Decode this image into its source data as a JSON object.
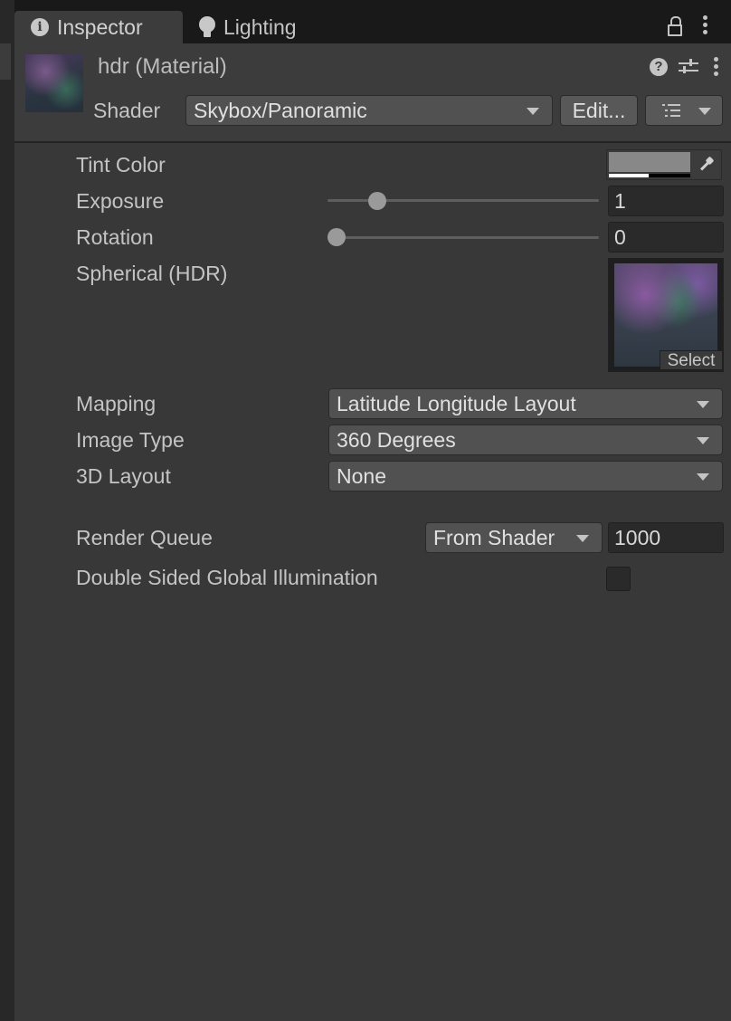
{
  "tabs": [
    {
      "label": "Inspector",
      "icon": "info-icon",
      "active": true
    },
    {
      "label": "Lighting",
      "icon": "lightbulb-icon",
      "active": false
    }
  ],
  "header": {
    "title": "hdr (Material)",
    "shader_label": "Shader",
    "shader_value": "Skybox/Panoramic",
    "edit_label": "Edit..."
  },
  "properties": {
    "tint": {
      "label": "Tint Color",
      "color": "#888888"
    },
    "exposure": {
      "label": "Exposure",
      "value": "1",
      "slider_fraction": 0.15
    },
    "rotation": {
      "label": "Rotation",
      "value": "0",
      "slider_fraction": 0.0
    },
    "spherical": {
      "label": "Spherical  (HDR)",
      "select_label": "Select"
    },
    "mapping": {
      "label": "Mapping",
      "value": "Latitude Longitude Layout"
    },
    "image_type": {
      "label": "Image Type",
      "value": "360 Degrees"
    },
    "layout_3d": {
      "label": "3D Layout",
      "value": "None"
    },
    "render_queue": {
      "label": "Render Queue",
      "mode": "From Shader",
      "value": "1000"
    },
    "double_sided_gi": {
      "label": "Double Sided Global Illumination",
      "checked": false
    }
  },
  "colors": {
    "panel_bg": "#383838",
    "header_bg": "#3c3c3c",
    "tab_bar_bg": "#191919",
    "field_bg": "#2a2a2a",
    "dropdown_bg": "#515151"
  }
}
